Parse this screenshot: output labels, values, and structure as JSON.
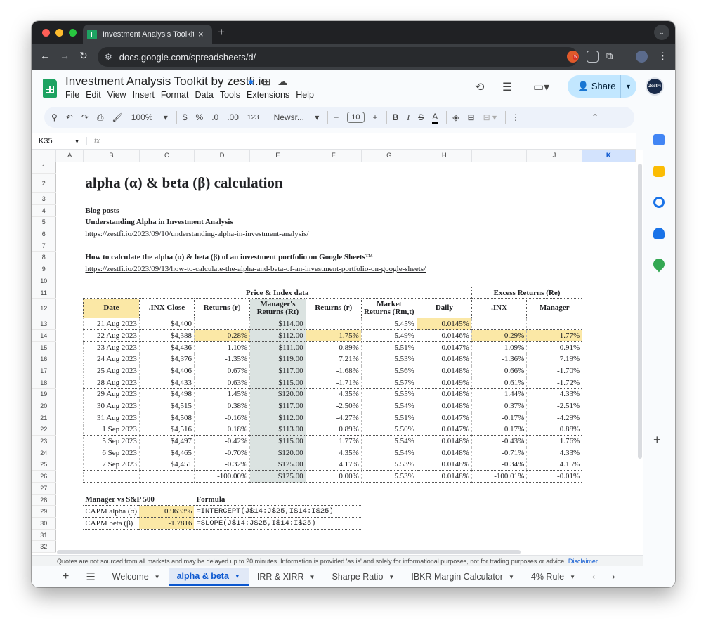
{
  "browser": {
    "tab_title": "Investment Analysis Toolkit b",
    "url": "docs.google.com/spreadsheets/d/",
    "ext_badge": "5"
  },
  "doc": {
    "title": "Investment Analysis Toolkit by zestfi.io",
    "menus": [
      "File",
      "Edit",
      "View",
      "Insert",
      "Format",
      "Data",
      "Tools",
      "Extensions",
      "Help"
    ],
    "share_label": "Share",
    "avatar_text": "ZestFi"
  },
  "toolbar": {
    "zoom": "100%",
    "currency": "$",
    "percent": "%",
    "dec_less": ".0",
    "dec_more": ".00",
    "number_format": "123",
    "font": "Newsr...",
    "font_size": "10"
  },
  "formula_bar": {
    "cell_ref": "K35",
    "fx": "fx"
  },
  "columns": [
    "A",
    "B",
    "C",
    "D",
    "E",
    "F",
    "G",
    "H",
    "I",
    "J",
    "K"
  ],
  "selected_column": "K",
  "content": {
    "heading": "alpha (α) & beta (β) calculation",
    "blog_posts": "Blog posts",
    "post1_title": "Understanding Alpha in Investment Analysis",
    "post1_url": "https://zestfi.io/2023/09/10/understanding-alpha-in-investment-analysis/",
    "post2_title": "How to calculate the alpha (α) & beta (β) of an investment portfolio on Google Sheets™",
    "post2_url": "https://zestfi.io/2023/09/13/how-to-calculate-the-alpha-and-beta-of-an-investment-portfolio-on-google-sheets/",
    "group_price": "Price & Index data",
    "group_excess": "Excess Returns (Re)",
    "headers": [
      "Date",
      ".INX Close",
      "Returns (r)",
      "Manager's Returns (Rt)",
      "Returns (r)",
      "Market Returns (Rm,t)",
      "Daily",
      ".INX",
      "Manager"
    ],
    "rows": [
      [
        "21 Aug 2023",
        "$4,400",
        "",
        "$114.00",
        "",
        "5.45%",
        "0.0145%",
        "",
        ""
      ],
      [
        "22 Aug 2023",
        "$4,388",
        "-0.28%",
        "$112.00",
        "-1.75%",
        "5.49%",
        "0.0146%",
        "-0.29%",
        "-1.77%"
      ],
      [
        "23 Aug 2023",
        "$4,436",
        "1.10%",
        "$111.00",
        "-0.89%",
        "5.51%",
        "0.0147%",
        "1.09%",
        "-0.91%"
      ],
      [
        "24 Aug 2023",
        "$4,376",
        "-1.35%",
        "$119.00",
        "7.21%",
        "5.53%",
        "0.0148%",
        "-1.36%",
        "7.19%"
      ],
      [
        "25 Aug 2023",
        "$4,406",
        "0.67%",
        "$117.00",
        "-1.68%",
        "5.56%",
        "0.0148%",
        "0.66%",
        "-1.70%"
      ],
      [
        "28 Aug 2023",
        "$4,433",
        "0.63%",
        "$115.00",
        "-1.71%",
        "5.57%",
        "0.0149%",
        "0.61%",
        "-1.72%"
      ],
      [
        "29 Aug 2023",
        "$4,498",
        "1.45%",
        "$120.00",
        "4.35%",
        "5.55%",
        "0.0148%",
        "1.44%",
        "4.33%"
      ],
      [
        "30 Aug 2023",
        "$4,515",
        "0.38%",
        "$117.00",
        "-2.50%",
        "5.54%",
        "0.0148%",
        "0.37%",
        "-2.51%"
      ],
      [
        "31 Aug 2023",
        "$4,508",
        "-0.16%",
        "$112.00",
        "-4.27%",
        "5.51%",
        "0.0147%",
        "-0.17%",
        "-4.29%"
      ],
      [
        "1 Sep 2023",
        "$4,516",
        "0.18%",
        "$113.00",
        "0.89%",
        "5.50%",
        "0.0147%",
        "0.17%",
        "0.88%"
      ],
      [
        "5 Sep 2023",
        "$4,497",
        "-0.42%",
        "$115.00",
        "1.77%",
        "5.54%",
        "0.0148%",
        "-0.43%",
        "1.76%"
      ],
      [
        "6 Sep 2023",
        "$4,465",
        "-0.70%",
        "$120.00",
        "4.35%",
        "5.54%",
        "0.0148%",
        "-0.71%",
        "4.33%"
      ],
      [
        "7 Sep 2023",
        "$4,451",
        "-0.32%",
        "$125.00",
        "4.17%",
        "5.53%",
        "0.0148%",
        "-0.34%",
        "4.15%"
      ],
      [
        "",
        "",
        "-100.00%",
        "$125.00",
        "0.00%",
        "5.53%",
        "0.0148%",
        "-100.01%",
        "-0.01%"
      ]
    ],
    "capm_heading": "Manager vs S&P 500",
    "formula_heading": "Formula",
    "alpha_label": "CAPM alpha (α)",
    "alpha_value": "0.9633%",
    "alpha_formula": "=INTERCEPT(J$14:J$25,I$14:I$25)",
    "beta_label": "CAPM beta (β)",
    "beta_value": "-1.7816",
    "beta_formula": "=SLOPE(J$14:J$25,I$14:I$25)"
  },
  "row_numbers": [
    "1",
    "2",
    "3",
    "4",
    "5",
    "6",
    "7",
    "8",
    "9",
    "10",
    "11",
    "12",
    "13",
    "14",
    "15",
    "16",
    "17",
    "18",
    "19",
    "20",
    "21",
    "22",
    "23",
    "24",
    "25",
    "26",
    "27",
    "28",
    "29",
    "30",
    "31",
    "32"
  ],
  "disclaimer": "Quotes are not sourced from all markets and may be delayed up to 20 minutes. Information is provided 'as is' and solely for informational purposes, not for trading purposes or advice.",
  "disclaimer_link": "Disclaimer",
  "sheet_tabs": [
    "Welcome",
    "alpha & beta",
    "IRR & XIRR",
    "Sharpe Ratio",
    "IBKR Margin Calculator",
    "4% Rule"
  ],
  "active_sheet": "alpha & beta",
  "colors": {
    "highlight_yellow": "#fbe8a6",
    "highlight_gray": "#dbe3e1",
    "accent": "#0b57d0",
    "share_bg": "#c2e7ff"
  }
}
